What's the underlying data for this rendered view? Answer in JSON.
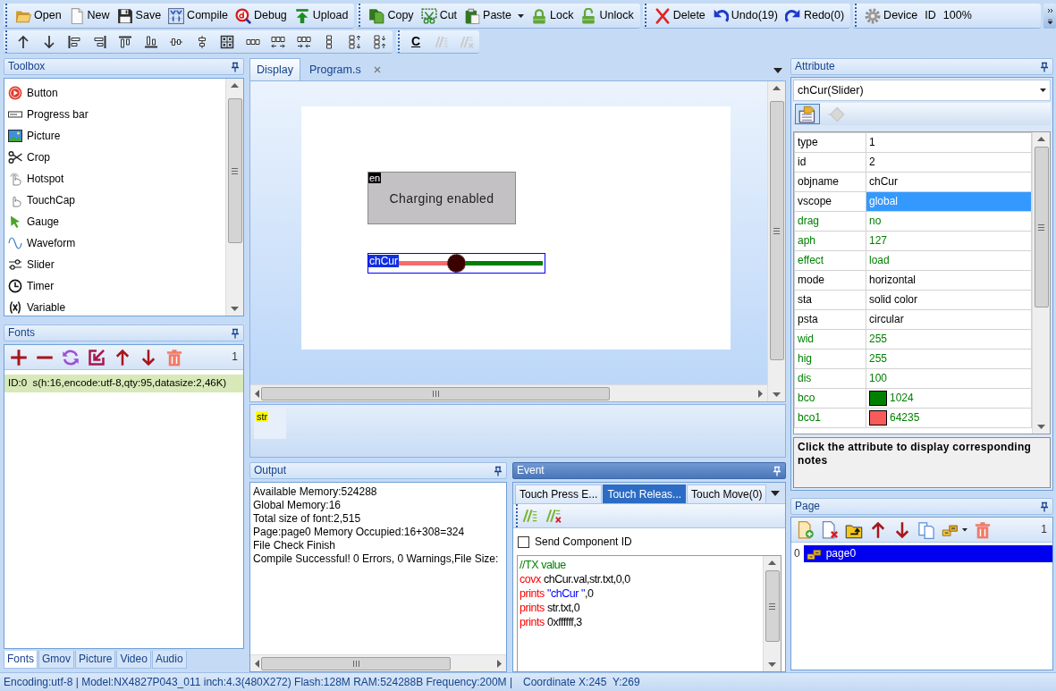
{
  "toolbar": {
    "groups": [
      {
        "items": [
          {
            "label": "Open",
            "dropdown": false
          },
          {
            "label": "New",
            "dropdown": false
          },
          {
            "label": "Save",
            "dropdown": false
          },
          {
            "label": "Compile",
            "dropdown": false
          },
          {
            "label": "Debug",
            "dropdown": false
          },
          {
            "label": "Upload",
            "dropdown": false
          }
        ]
      },
      {
        "items": [
          {
            "label": "Copy",
            "dropdown": false
          },
          {
            "label": "Cut",
            "dropdown": false
          },
          {
            "label": "Paste",
            "dropdown": true
          },
          {
            "label": "Lock",
            "dropdown": false
          },
          {
            "label": "Unlock",
            "dropdown": false
          }
        ]
      },
      {
        "items": [
          {
            "label": "Delete",
            "dropdown": false
          },
          {
            "label": "Undo(19)",
            "dropdown": false
          },
          {
            "label": "Redo(0)",
            "dropdown": false
          }
        ]
      },
      {
        "items": [
          {
            "label": "Device",
            "dropdown": false
          },
          {
            "label": "ID",
            "dropdown": false
          },
          {
            "label": "100%",
            "dropdown": false
          }
        ]
      }
    ]
  },
  "layout_toolbar": {
    "groups": [
      {
        "items": [
          {
            "disabled": false
          },
          {
            "disabled": false
          },
          {
            "disabled": false
          },
          {
            "disabled": false
          },
          {
            "disabled": false
          },
          {
            "disabled": false
          },
          {
            "disabled": false
          },
          {
            "disabled": false
          },
          {
            "disabled": false
          },
          {
            "disabled": false
          },
          {
            "disabled": false
          },
          {
            "disabled": false
          },
          {
            "disabled": false
          },
          {
            "disabled": false
          },
          {
            "disabled": false
          }
        ]
      },
      {
        "items": [
          {
            "label": "C",
            "disabled": false
          },
          {
            "disabled": true
          },
          {
            "disabled": true
          }
        ]
      }
    ]
  },
  "toolbox": {
    "title": "Toolbox",
    "active": false,
    "items": [
      {
        "label": "Button"
      },
      {
        "label": "Progress bar"
      },
      {
        "label": "Picture"
      },
      {
        "label": "Crop"
      },
      {
        "label": "Hotspot"
      },
      {
        "label": "TouchCap"
      },
      {
        "label": "Gauge"
      },
      {
        "label": "Waveform"
      },
      {
        "label": "Slider"
      },
      {
        "label": "Timer"
      },
      {
        "label": "Variable"
      }
    ]
  },
  "fonts": {
    "title": "Fonts",
    "active": false,
    "count": "1",
    "items": [
      {
        "label": "ID:0  s(h:16,encode:utf-8,qty:95,datasize:2,46K)",
        "selected": true
      }
    ]
  },
  "left_tabs": [
    {
      "label": "Fonts",
      "selected": true
    },
    {
      "label": "Gmov",
      "selected": false
    },
    {
      "label": "Picture",
      "selected": false
    },
    {
      "label": "Video",
      "selected": false
    },
    {
      "label": "Audio",
      "selected": false
    }
  ],
  "document_tabs": [
    {
      "label": "Display",
      "selected": true,
      "closable": false
    },
    {
      "label": "Program.s",
      "selected": false,
      "closable": true
    }
  ],
  "canvas": {
    "objects": [
      {
        "kind": "button",
        "tag": "en",
        "text": "Charging enabled",
        "selected": false
      },
      {
        "kind": "slider",
        "tag": "chCur",
        "level": 0.4,
        "selected": true
      }
    ]
  },
  "variables": [
    {
      "label": "str"
    }
  ],
  "output": {
    "title": "Output",
    "active": false,
    "lines": [
      "Available Memory:524288",
      "Global Memory:16",
      "Total size of font:2,515",
      "Page:page0 Memory Occupied:16+308=324",
      "File Check Finish",
      "Compile Successful! 0 Errors, 0 Warnings,File Size:"
    ]
  },
  "event": {
    "title": "Event",
    "active": true,
    "tabs": [
      {
        "label": "Touch Press E...",
        "selected": false
      },
      {
        "label": "Touch Releas...",
        "selected": true
      },
      {
        "label": "Touch Move(0)",
        "selected": false
      }
    ],
    "send_component_id": {
      "label": "Send Component ID",
      "checked": false
    },
    "code": [
      [
        {
          "kind": "comment",
          "text": "//TX value"
        }
      ],
      [
        {
          "kind": "keyword",
          "text": "covx"
        },
        {
          "kind": "plain",
          "text": " chCur.val,str.txt,0,0"
        }
      ],
      [
        {
          "kind": "keyword",
          "text": "prints"
        },
        {
          "kind": "string",
          "text": " \"chCur \""
        },
        {
          "kind": "plain",
          "text": ",0"
        }
      ],
      [
        {
          "kind": "keyword",
          "text": "prints"
        },
        {
          "kind": "plain",
          "text": " str.txt,0"
        }
      ],
      [
        {
          "kind": "keyword",
          "text": "prints"
        },
        {
          "kind": "plain",
          "text": " 0xffffff,3"
        }
      ]
    ]
  },
  "attribute": {
    "title": "Attribute",
    "active": false,
    "object": "chCur(Slider)",
    "tools": [
      {
        "selected": true,
        "disabled": false
      },
      {
        "selected": false,
        "disabled": true
      }
    ],
    "rows": [
      {
        "name": "type",
        "value": "1",
        "runtime": false,
        "selected": false
      },
      {
        "name": "id",
        "value": "2",
        "runtime": false,
        "selected": false
      },
      {
        "name": "objname",
        "value": "chCur",
        "runtime": false,
        "selected": false
      },
      {
        "name": "vscope",
        "value": "global",
        "runtime": false,
        "selected": true
      },
      {
        "name": "drag",
        "value": "no",
        "runtime": true,
        "selected": false
      },
      {
        "name": "aph",
        "value": "127",
        "runtime": true,
        "selected": false
      },
      {
        "name": "effect",
        "value": "load",
        "runtime": true,
        "selected": false
      },
      {
        "name": "mode",
        "value": "horizontal",
        "runtime": false,
        "selected": false
      },
      {
        "name": "sta",
        "value": "solid color",
        "runtime": false,
        "selected": false
      },
      {
        "name": "psta",
        "value": "circular",
        "runtime": false,
        "selected": false
      },
      {
        "name": "wid",
        "value": "255",
        "runtime": true,
        "selected": false
      },
      {
        "name": "hig",
        "value": "255",
        "runtime": true,
        "selected": false
      },
      {
        "name": "dis",
        "value": "100",
        "runtime": true,
        "selected": false
      },
      {
        "name": "bco",
        "value": "1024",
        "runtime": true,
        "selected": false,
        "color": "#008000"
      },
      {
        "name": "bco1",
        "value": "64235",
        "runtime": true,
        "selected": false,
        "color": "#f85c5a"
      }
    ],
    "note": "Click the attribute to display corresponding notes"
  },
  "page": {
    "title": "Page",
    "active": false,
    "count": "1",
    "items": [
      {
        "index": "0",
        "label": "page0",
        "selected": true
      }
    ]
  },
  "status_bar": {
    "info": "Encoding:utf-8 | Model:NX4827P043_011 inch:4.3(480X272) Flash:128M RAM:524288B Frequency:200M |",
    "coordinate": "Coordinate X:245  Y:269"
  }
}
